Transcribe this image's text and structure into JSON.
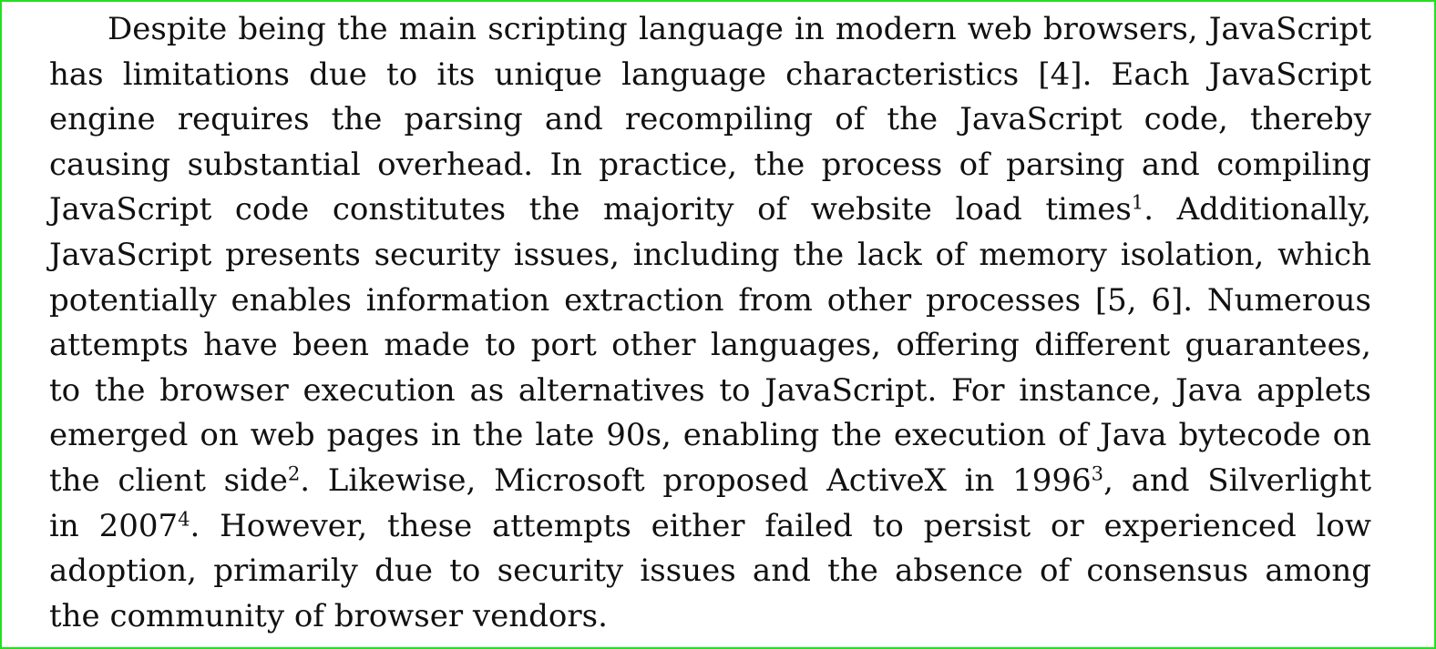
{
  "paragraph": {
    "lines": [
      [
        {
          "t": "Despite being the main scripting language in modern web browsers, JavaScript"
        }
      ],
      [
        {
          "t": "has limitations due to its unique language characteristics [4].  Each JavaScript"
        }
      ],
      [
        {
          "t": "engine requires the parsing and recompiling of the JavaScript code, thereby"
        }
      ],
      [
        {
          "t": "causing substantial overhead.  In practice, the process of parsing and compiling"
        }
      ],
      [
        {
          "t": "JavaScript code constitutes the majority of website load times"
        },
        {
          "sup": "1"
        },
        {
          "t": ".  Additionally,"
        }
      ],
      [
        {
          "t": "JavaScript presents security issues, including the lack of memory isolation, which"
        }
      ],
      [
        {
          "t": "potentially enables information extraction from other processes [5, 6].  Numerous"
        }
      ],
      [
        {
          "t": "attempts have been made to port other languages, offering different guarantees,"
        }
      ],
      [
        {
          "t": "to the browser execution as alternatives to JavaScript.  For instance, Java applets"
        }
      ],
      [
        {
          "t": "emerged on web pages in the late 90s, enabling the execution of Java bytecode on"
        }
      ],
      [
        {
          "t": "the client side"
        },
        {
          "sup": "2"
        },
        {
          "t": ".  Likewise, Microsoft proposed ActiveX in 1996"
        },
        {
          "sup": "3"
        },
        {
          "t": ", and Silverlight"
        }
      ],
      [
        {
          "t": "in 2007"
        },
        {
          "sup": "4"
        },
        {
          "t": ".  However, these attempts either failed to persist or experienced low"
        }
      ],
      [
        {
          "t": "adoption, primarily due to security issues and the absence of consensus among"
        }
      ],
      [
        {
          "t": "the community of browser vendors."
        }
      ]
    ]
  }
}
